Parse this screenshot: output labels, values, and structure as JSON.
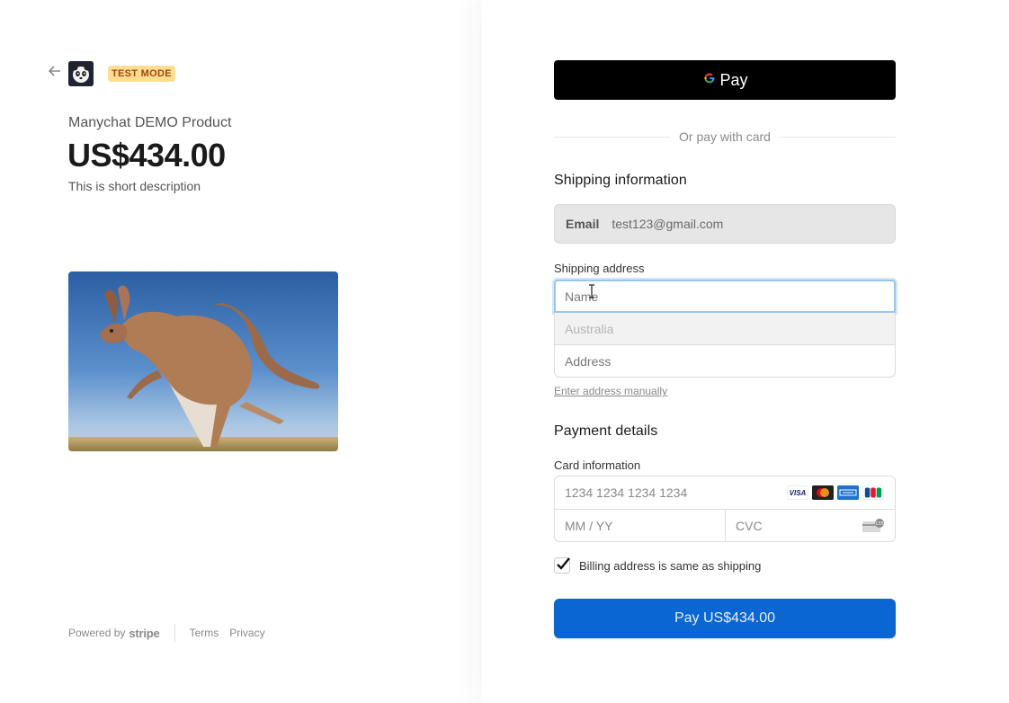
{
  "left": {
    "back_icon": "arrow-left-icon",
    "logo_icon": "panda-logo-icon",
    "test_badge": "TEST MODE",
    "product_name": "Manychat DEMO Product",
    "price": "US$434.00",
    "description": "This is short description",
    "footer": {
      "powered_by": "Powered by",
      "stripe": "stripe",
      "terms": "Terms",
      "privacy": "Privacy"
    }
  },
  "right": {
    "gpay_label": "Pay",
    "gpay_g": "G",
    "or_text": "Or pay with card",
    "shipping_title": "Shipping information",
    "email": {
      "label": "Email",
      "value": "test123@gmail.com"
    },
    "shipping_address_label": "Shipping address",
    "address": {
      "name_placeholder": "Name",
      "country": "Australia",
      "address_placeholder": "Address"
    },
    "manual_link": "Enter address manually",
    "payment_title": "Payment details",
    "card_info_label": "Card information",
    "card": {
      "number_placeholder": "1234 1234 1234 1234",
      "expiry_placeholder": "MM / YY",
      "cvc_placeholder": "CVC",
      "brands": [
        "VISA",
        "Mastercard",
        "Amex",
        "JCB"
      ]
    },
    "billing_same": "Billing address is same as shipping",
    "billing_checked": true,
    "pay_button": "Pay US$434.00"
  },
  "colors": {
    "pay_button": "#0a66d2",
    "test_badge_bg": "#ffde92",
    "test_badge_text": "#a1460b",
    "focus_ring": "#99c7ec"
  }
}
